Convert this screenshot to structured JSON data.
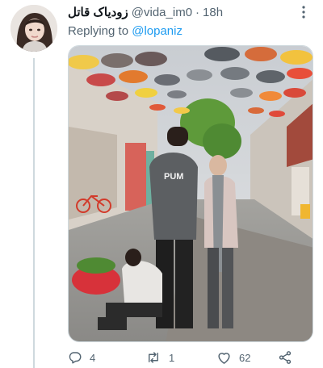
{
  "tweet": {
    "display_name": "زودیاک قاتل",
    "handle": "@vida_im0",
    "separator": "·",
    "time": "18h",
    "reply_prefix": "Replying to",
    "reply_to": "@lopaniz",
    "shirt_text": "PUM"
  },
  "actions": {
    "replies": "4",
    "retweets": "1",
    "likes": "62"
  },
  "icons": {
    "avatar": "avatar",
    "more": "more-icon",
    "reply": "reply-icon",
    "retweet": "retweet-icon",
    "like": "heart-icon",
    "share": "share-icon"
  },
  "colors": {
    "link": "#1d9bf0",
    "secondary_text": "#536471",
    "primary_text": "#0f1419",
    "thread_line": "#cfd9de"
  }
}
